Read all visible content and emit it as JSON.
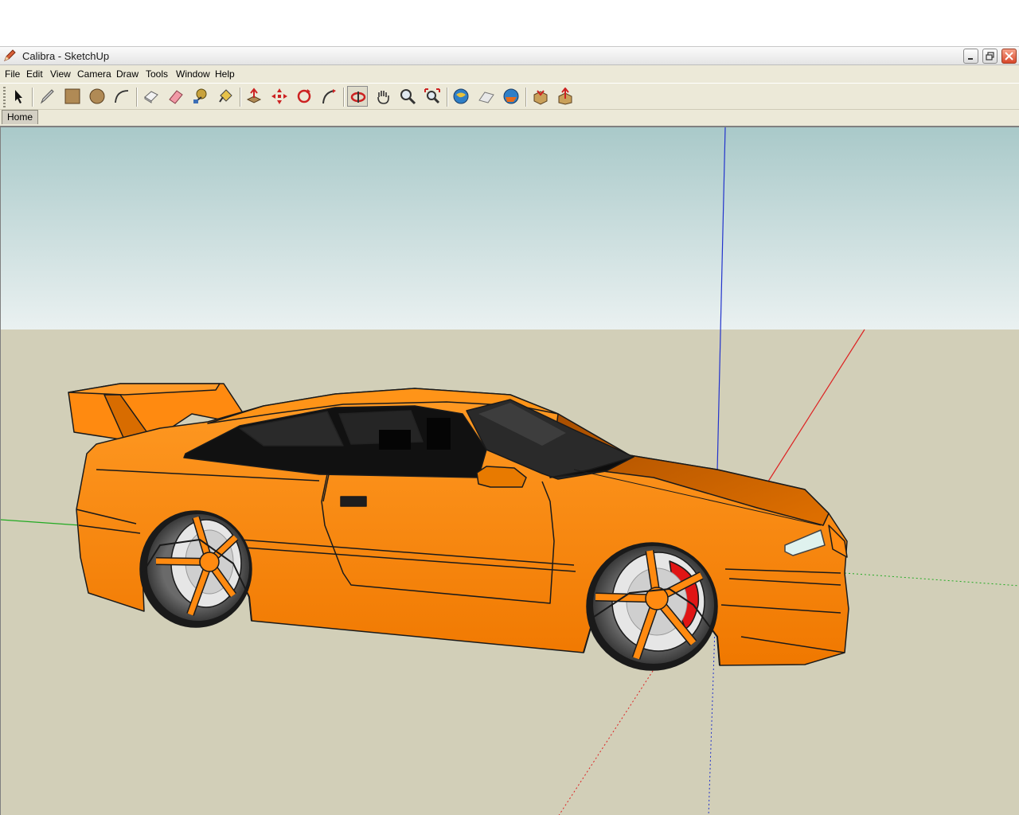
{
  "window": {
    "title": "Calibra - SketchUp",
    "app_icon": "sketchup-pencil-icon"
  },
  "menu": [
    "File",
    "Edit",
    "View",
    "Camera",
    "Draw",
    "Tools",
    "Window",
    "Help"
  ],
  "toolbar": {
    "tools": [
      "select-tool-icon",
      "line-tool-icon",
      "rectangle-tool-icon",
      "circle-tool-icon",
      "arc-tool-icon",
      "make-component-icon",
      "eraser-tool-icon",
      "tape-measure-icon",
      "paint-bucket-icon",
      "push-pull-icon",
      "move-tool-icon",
      "rotate-tool-icon",
      "follow-me-icon",
      "orbit-tool-icon",
      "pan-tool-icon",
      "zoom-tool-icon",
      "zoom-extents-icon",
      "get-current-view-icon",
      "toggle-terrain-icon",
      "place-model-icon",
      "get-models-icon",
      "share-model-icon"
    ],
    "active_tool": "orbit-tool-icon"
  },
  "scene_tab": "Home",
  "colors": {
    "sky_top": "#a8c8c8",
    "sky_bottom": "#e8f0f0",
    "ground": "#d2cfb8",
    "car_body": "#ff8a0a",
    "x_axis": "#dd2222",
    "y_axis": "#22aa22",
    "z_axis": "#2233cc"
  }
}
